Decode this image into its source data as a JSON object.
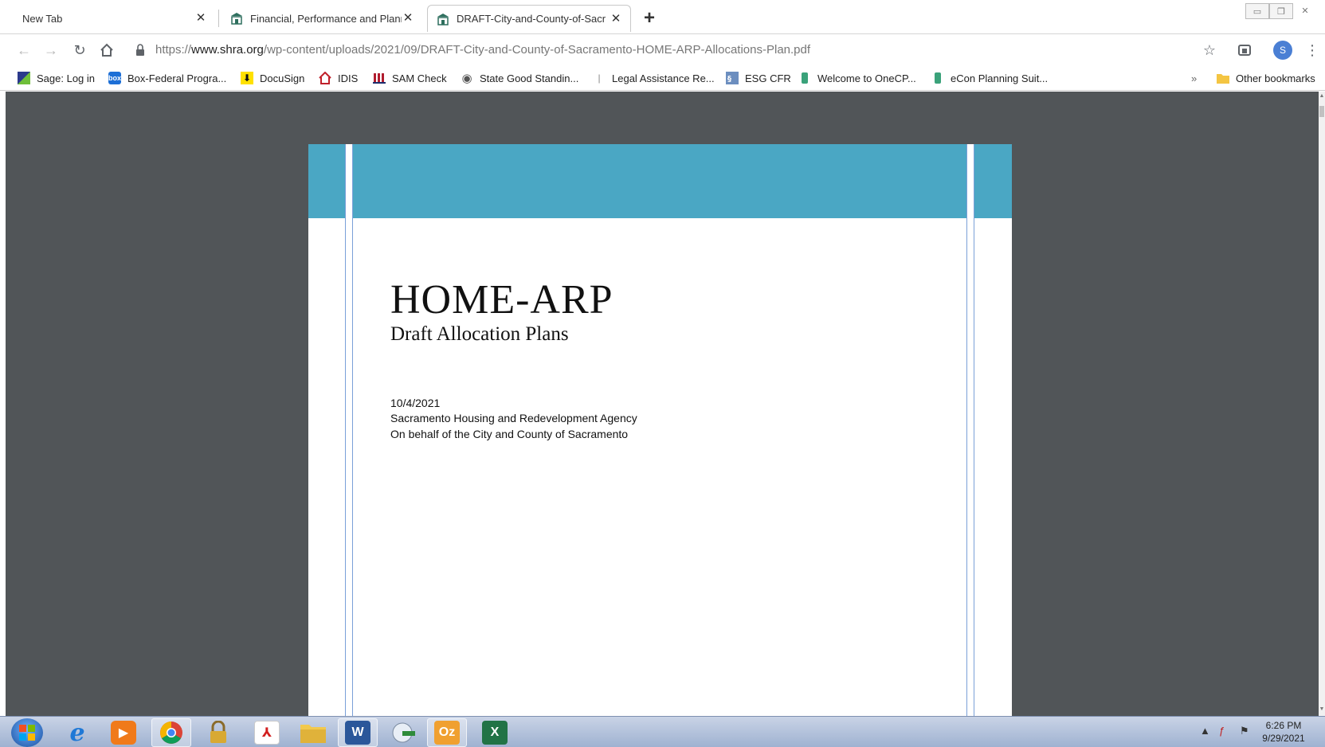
{
  "browser": {
    "tabs": [
      {
        "title": "New Tab",
        "active": false
      },
      {
        "title": "Financial, Performance and Planni",
        "active": false
      },
      {
        "title": "DRAFT-City-and-County-of-Sacr",
        "active": true
      }
    ],
    "url": {
      "scheme": "https://",
      "domain": "www.shra.org",
      "path": "/wp-content/uploads/2021/09/DRAFT-City-and-County-of-Sacramento-HOME-ARP-Allocations-Plan.pdf"
    },
    "avatar_letter": "S"
  },
  "bookmarks": {
    "items": [
      {
        "label": "Sage: Log in",
        "icon": "sage-icon"
      },
      {
        "label": "Box-Federal Progra...",
        "icon": "box-icon"
      },
      {
        "label": "DocuSign",
        "icon": "docusign-icon"
      },
      {
        "label": "IDIS",
        "icon": "idis-house-icon"
      },
      {
        "label": "SAM Check",
        "icon": "sam-icon"
      },
      {
        "label": "State Good Standin...",
        "icon": "globe-icon"
      },
      {
        "label": "Legal Assistance Re...",
        "icon": "page-icon"
      },
      {
        "label": "ESG CFR",
        "icon": "esg-icon"
      },
      {
        "label": "Welcome to OneCP...",
        "icon": "onecpd-icon"
      },
      {
        "label": "eCon Planning Suit...",
        "icon": "econ-icon"
      }
    ],
    "overflow": "»",
    "other": "Other bookmarks"
  },
  "document": {
    "title": "HOME-ARP",
    "subtitle": "Draft Allocation Plans",
    "date": "10/4/2021",
    "agency": "Sacramento Housing and Redevelopment Agency",
    "behalf": "On behalf of the City and County of Sacramento",
    "banner_color": "#4aa7c4"
  },
  "taskbar": {
    "apps": [
      "internet-explorer",
      "media-player",
      "chrome",
      "lock-app",
      "acrobat",
      "file-explorer",
      "word",
      "network",
      "outlook",
      "excel"
    ],
    "time": "6:26 PM",
    "date": "9/29/2021"
  }
}
